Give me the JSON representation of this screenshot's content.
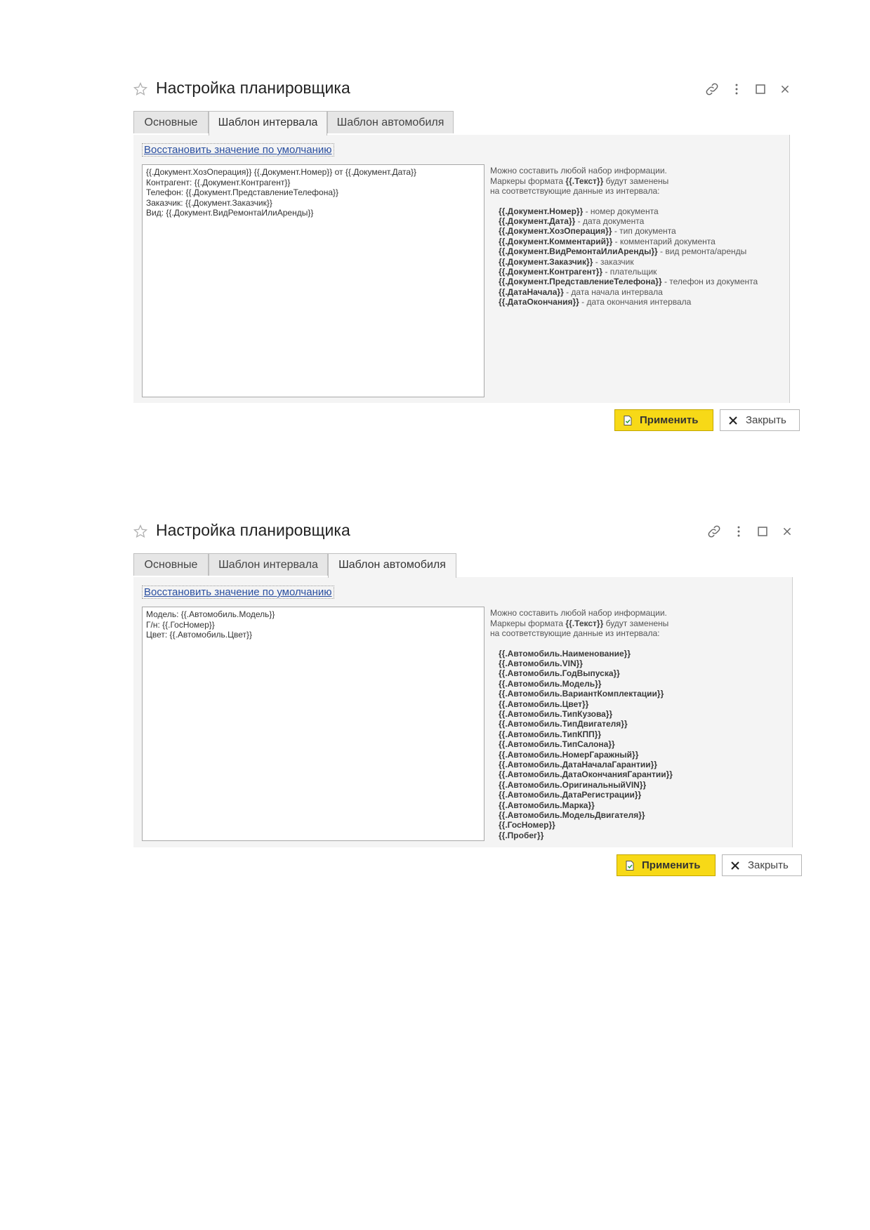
{
  "panels": [
    {
      "title": "Настройка планировщика",
      "tabs": [
        "Основные",
        "Шаблон интервала",
        "Шаблон автомобиля"
      ],
      "active_tab": 1,
      "restore_link": "Восстановить значение по умолчанию",
      "editor_lines": [
        "{{.Документ.ХозОперация}} {{.Документ.Номер}} от {{.Документ.Дата}}",
        "Контрагент: {{.Документ.Контрагент}}",
        "Телефон: {{.Документ.ПредставлениеТелефона}}",
        "Заказчик: {{.Документ.Заказчик}}",
        "Вид: {{.Документ.ВидРемонтаИлиАренды}}"
      ],
      "help": {
        "line1": "Можно составить любой набор информации.",
        "line2_prefix": "Маркеры формата ",
        "line2_marker": "{{.Текст}}",
        "line2_suffix": " будут заменены",
        "line3": "на соответствующие данные из интервала:"
      },
      "markers": [
        {
          "key": "{{.Документ.Номер}}",
          "desc": " - номер документа"
        },
        {
          "key": "{{.Документ.Дата}}",
          "desc": " - дата документа"
        },
        {
          "key": "{{.Документ.ХозОперация}}",
          "desc": " - тип документа"
        },
        {
          "key": "{{.Документ.Комментарий}}",
          "desc": " - комментарий документа"
        },
        {
          "key": "{{.Документ.ВидРемонтаИлиАренды}}",
          "desc": " - вид ремонта/аренды"
        },
        {
          "key": "{{.Документ.Заказчик}}",
          "desc": " - заказчик"
        },
        {
          "key": "{{.Документ.Контрагент}}",
          "desc": " - плательщик"
        },
        {
          "key": "{{.Документ.ПредставлениеТелефона}}",
          "desc": " - телефон из документа"
        },
        {
          "key": "{{.ДатаНачала}}",
          "desc": " - дата начала интервала"
        },
        {
          "key": "{{.ДатаОкончания}}",
          "desc": " - дата окончания интервала"
        }
      ],
      "apply_label": "Применить",
      "close_label": "Закрыть"
    },
    {
      "title": "Настройка планировщика",
      "tabs": [
        "Основные",
        "Шаблон интервала",
        "Шаблон автомобиля"
      ],
      "active_tab": 2,
      "restore_link": "Восстановить значение по умолчанию",
      "editor_lines": [
        "Модель: {{.Автомобиль.Модель}}",
        "Г/н: {{.ГосНомер}}",
        "Цвет: {{.Автомобиль.Цвет}}"
      ],
      "help": {
        "line1": "Можно составить любой набор информации.",
        "line2_prefix": "Маркеры формата ",
        "line2_marker": "{{.Текст}}",
        "line2_suffix": " будут заменены",
        "line3": "на соответствующие данные из интервала:"
      },
      "markers": [
        {
          "key": "{{.Автомобиль.Наименование}}",
          "desc": ""
        },
        {
          "key": "{{.Автомобиль.VIN}}",
          "desc": ""
        },
        {
          "key": "{{.Автомобиль.ГодВыпуска}}",
          "desc": ""
        },
        {
          "key": "{{.Автомобиль.Модель}}",
          "desc": ""
        },
        {
          "key": "{{.Автомобиль.ВариантКомплектации}}",
          "desc": ""
        },
        {
          "key": "{{.Автомобиль.Цвет}}",
          "desc": ""
        },
        {
          "key": "{{.Автомобиль.ТипКузова}}",
          "desc": ""
        },
        {
          "key": "{{.Автомобиль.ТипДвигателя}}",
          "desc": ""
        },
        {
          "key": "{{.Автомобиль.ТипКПП}}",
          "desc": ""
        },
        {
          "key": "{{.Автомобиль.ТипСалона}}",
          "desc": ""
        },
        {
          "key": "{{.Автомобиль.НомерГаражный}}",
          "desc": ""
        },
        {
          "key": "{{.Автомобиль.ДатаНачалаГарантии}}",
          "desc": ""
        },
        {
          "key": "{{.Автомобиль.ДатаОкончанияГарантии}}",
          "desc": ""
        },
        {
          "key": "{{.Автомобиль.ОригинальныйVIN}}",
          "desc": ""
        },
        {
          "key": "{{.Автомобиль.ДатаРегистрации}}",
          "desc": ""
        },
        {
          "key": "{{.Автомобиль.Марка}}",
          "desc": ""
        },
        {
          "key": "{{.Автомобиль.МодельДвигателя}}",
          "desc": ""
        },
        {
          "key": "{{.ГосНомер}}",
          "desc": ""
        },
        {
          "key": "{{.Пробег}}",
          "desc": ""
        }
      ],
      "apply_label": "Применить",
      "close_label": "Закрыть"
    }
  ],
  "icons": {
    "favorite": "star-icon",
    "link": "link-icon",
    "more": "more-icon",
    "maximize": "maximize-icon",
    "close": "close-icon",
    "apply": "document-check-icon",
    "close_button": "x-icon"
  },
  "colors": {
    "apply_button": "#f7d917",
    "link": "#2a4fa0",
    "content_bg": "#f4f4f4"
  }
}
